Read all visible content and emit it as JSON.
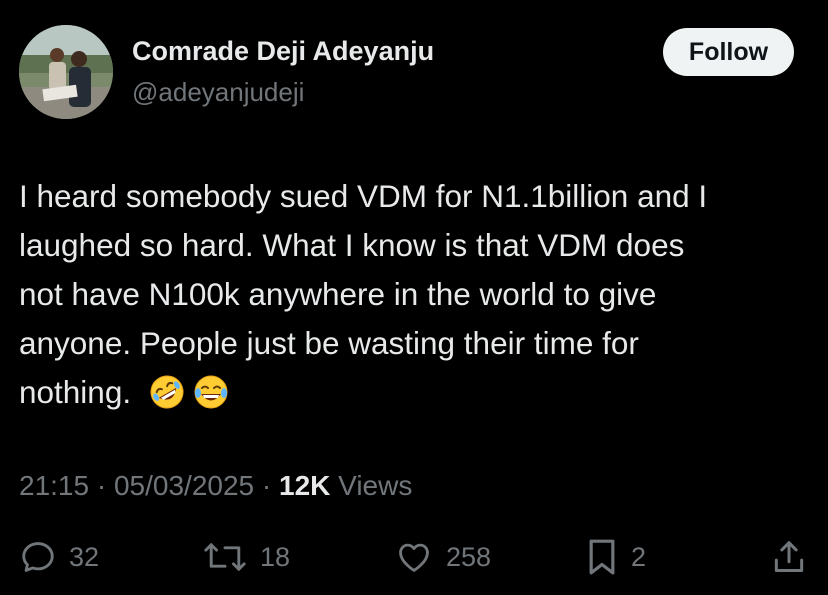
{
  "author": {
    "display_name": "Comrade Deji Adeyanju",
    "handle": "@adeyanjudeji",
    "avatar_icon": "profile-photo"
  },
  "follow_button": {
    "label": "Follow"
  },
  "tweet": {
    "lines": [
      "I heard somebody sued VDM for N1.1billion and I",
      "laughed so hard. What I know is that VDM does",
      "not have N100k anywhere in the world to give",
      "anyone. People just be wasting their time for",
      "nothing."
    ],
    "emojis": [
      "rolling-on-floor-laughing",
      "face-with-tears-of-joy"
    ]
  },
  "meta": {
    "time": "21:15",
    "separator": "·",
    "date": "05/03/2025",
    "views_count": "12K",
    "views_label": "Views"
  },
  "actions": {
    "replies": "32",
    "reposts": "18",
    "likes": "258",
    "bookmarks": "2"
  },
  "colors": {
    "background": "#000000",
    "primary_text": "#e7e9ea",
    "secondary_text": "#71767b",
    "follow_button_bg": "#eff3f4",
    "follow_button_text": "#0f1419"
  }
}
